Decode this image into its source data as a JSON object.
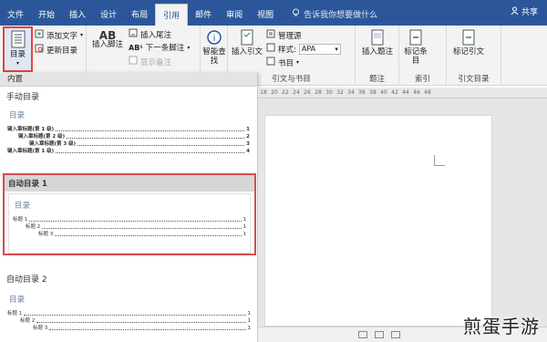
{
  "tabs": [
    "文件",
    "开始",
    "插入",
    "设计",
    "布局",
    "引用",
    "邮件",
    "审阅",
    "视图"
  ],
  "active_tab": "引用",
  "tell_me": "告诉我你想要做什么",
  "share": "共享",
  "ribbon": {
    "toc_button": "目录",
    "add_text": "添加文字",
    "update_toc": "更新目录",
    "insert_footnote": "插入脚注",
    "ab_label": "AB",
    "insert_endnote": "插入尾注",
    "next_footnote": "下一条脚注",
    "show_notes": "显示备注",
    "smart_lookup": "智能查找",
    "insert_citation": "插入引文",
    "manage_sources": "管理源",
    "style_label": "样式:",
    "style_value": "APA",
    "bibliography": "书目",
    "citations_group": "引文与书目",
    "insert_caption": "插入题注",
    "captions_group": "题注",
    "mark_entry": "标记条目",
    "index_group": "索引",
    "mark_citation": "标记引文",
    "toa_group": "引文目录"
  },
  "gallery": {
    "header": "内置",
    "manual_title": "手动目录",
    "manual_heading": "目录",
    "manual_lines": [
      {
        "text": "键入章标题(第 1 级)",
        "page": "1",
        "level": 1
      },
      {
        "text": "键入章标题(第 2 级)",
        "page": "2",
        "level": 2
      },
      {
        "text": "键入章标题(第 3 级)",
        "page": "3",
        "level": 3
      },
      {
        "text": "键入章标题(第 1 级)",
        "page": "4",
        "level": 1
      }
    ],
    "auto1_title": "自动目录 1",
    "auto1_heading": "目录",
    "auto1_lines": [
      {
        "text": "标题 1",
        "page": "1",
        "level": 1
      },
      {
        "text": "标题 2",
        "page": "1",
        "level": 2
      },
      {
        "text": "标题 3",
        "page": "1",
        "level": 3
      }
    ],
    "auto2_title": "自动目录 2",
    "auto2_heading": "目录",
    "auto2_lines": [
      {
        "text": "标题 1",
        "page": "1",
        "level": 1
      },
      {
        "text": "标题 2",
        "page": "1",
        "level": 2
      },
      {
        "text": "标题 3",
        "page": "1",
        "level": 3
      }
    ]
  },
  "ruler_marks": [
    "18",
    "20",
    "22",
    "24",
    "26",
    "28",
    "30",
    "32",
    "34",
    "36",
    "38",
    "40",
    "42",
    "44",
    "46",
    "48"
  ],
  "watermark": "煎蛋手游",
  "colors": {
    "accent": "#2b579a",
    "highlight": "#d84c4c"
  }
}
